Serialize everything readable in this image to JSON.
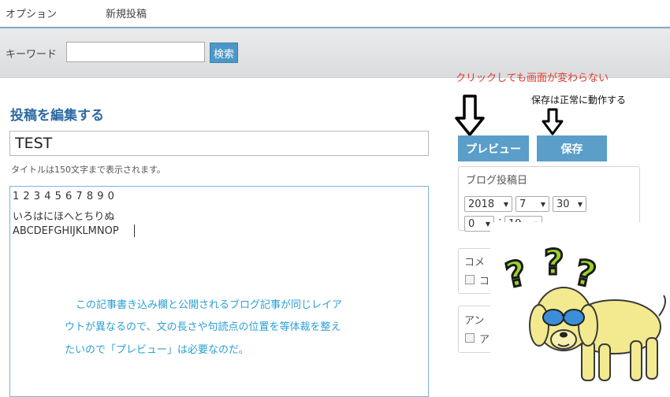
{
  "nav": {
    "options": "オプション",
    "new_post": "新規投稿"
  },
  "search": {
    "label": "キーワード",
    "value": "",
    "button": "検索"
  },
  "editor": {
    "heading": "投稿を編集する",
    "title_value": "TEST",
    "title_note": "タイトルは150文字まで表示されます。",
    "body_lines": [
      "1 2 3 4 5 6 7 8 9 0",
      "いろはにほへとちりぬ",
      "ABCDEFGHIJKLMNOP"
    ]
  },
  "annotations": {
    "preview_broken": "クリックしても画面が変わらない",
    "save_works": "保存は正常に動作する",
    "body_note": [
      "この記事書き込み欄と公開されるブログ記事が同じレイア",
      "ウトが異なるので、文の長さや句読点の位置を等体裁を整え",
      "たいので「プレビュー」は必要なのだ。"
    ]
  },
  "actions": {
    "preview": "プレビュー",
    "save": "保存"
  },
  "post_date": {
    "title": "ブログ投稿日",
    "year": "2018",
    "month": "7",
    "day": "30",
    "hour": "0",
    "minute": "19"
  },
  "comments_panel": {
    "title": "コメ",
    "checkbox_label": "コ"
  },
  "answer_panel": {
    "title": "アン",
    "checkbox_label": "ア"
  },
  "icons": [
    "arrow-down-outline-icon",
    "question-mark-icon",
    "dog-sunglasses-illustration"
  ],
  "colors": {
    "accent": "#5a9ec9",
    "heading": "#2d6aa2",
    "warning": "#e23a2f",
    "note": "#2ba0d6"
  }
}
